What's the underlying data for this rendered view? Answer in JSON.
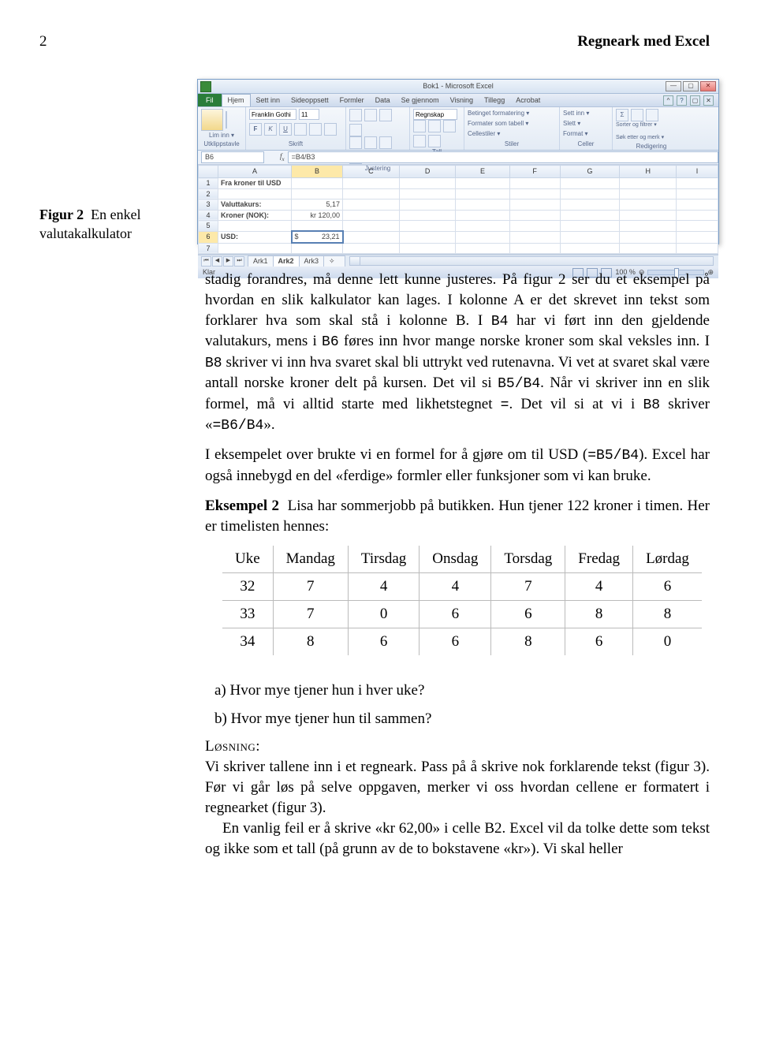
{
  "page": {
    "num": "2",
    "title": "Regneark med Excel"
  },
  "figcap": {
    "label": "Figur 2",
    "text": "En enkel valutakalkulator"
  },
  "excel": {
    "title": "Bok1 - Microsoft Excel",
    "tabs": {
      "file": "Fil",
      "items": [
        "Hjem",
        "Sett inn",
        "Sideoppsett",
        "Formler",
        "Data",
        "Se gjennom",
        "Visning",
        "Tillegg",
        "Acrobat"
      ]
    },
    "ribbon": {
      "clipboard": "Utklippstavle",
      "clipboard_btn": "Lim inn ▾",
      "font": "Skrift",
      "font_name": "Franklin Gothi",
      "font_size": "11",
      "align": "Justering",
      "number": "Tall",
      "number_fmt": "Regnskap",
      "styles": "Stiler",
      "styles_items": [
        "Betinget formatering ▾",
        "Formater som tabell ▾",
        "Cellestiler ▾"
      ],
      "cells": "Celler",
      "cells_items": [
        "Sett inn ▾",
        "Slett ▾",
        "Format ▾"
      ],
      "editing": "Redigering",
      "editing_items": [
        "Sorter og filtrer ▾",
        "Søk etter og merk ▾"
      ]
    },
    "namebox": "B6",
    "formula": "=B4/B3",
    "cols": [
      "",
      "A",
      "B",
      "C",
      "D",
      "E",
      "F",
      "G",
      "H",
      "I"
    ],
    "rows": [
      {
        "r": "1",
        "a": "Fra kroner til USD",
        "b": ""
      },
      {
        "r": "2",
        "a": "",
        "b": ""
      },
      {
        "r": "3",
        "a": "Valuttakurs:",
        "b": "5,17"
      },
      {
        "r": "4",
        "a": "Kroner (NOK):",
        "b": "kr 120,00"
      },
      {
        "r": "5",
        "a": "",
        "b": ""
      },
      {
        "r": "6",
        "a": "USD:",
        "b": "23,21",
        "sel": true,
        "dollar": "$"
      },
      {
        "r": "7",
        "a": "",
        "b": ""
      }
    ],
    "sheets": [
      "Ark1",
      "Ark2",
      "Ark3"
    ],
    "status": "Klar",
    "zoom": "100 %"
  },
  "paras": {
    "p1a": "stadig forandres, må denne lett kunne justeres. På figur 2 ser du et eksempel på hvordan en slik kalkulator kan lages. I kolonne A er det skrevet inn tekst som forklarer hva som skal stå i kolonne B. I ",
    "p1b": " har vi ført inn den gjeldende valutakurs, mens i ",
    "p1c": " føres inn hvor mange norske kroner som skal veksles inn. I ",
    "p1d": " skriver vi inn hva svaret skal bli uttrykt ved rutenavna. Vi vet at svaret skal være antall norske kroner delt på kursen. Det vil si ",
    "p1e": ". Når vi skriver inn en slik formel, må vi alltid starte med likhetstegnet ",
    "p1f": ". Det vil si at vi i ",
    "p1g": " skriver «",
    "p1h": "».",
    "p2a": "I eksempelet over brukte vi en formel for å gjøre om til USD (",
    "p2b": "). Excel har også innebygd en del «ferdige» formler eller funksjoner som vi kan bruke.",
    "eks_label": "Eksempel 2",
    "eks_text": "Lisa har sommerjobb på butikken. Hun tjener 122 kroner i timen. Her er timelisten hennes:",
    "q_a": "a)  Hvor mye tjener hun i hver uke?",
    "q_b": "b)  Hvor mye tjener hun til sammen?",
    "losning_hd": "Løsning:",
    "losning_p1": "Vi skriver tallene inn i et regneark. Pass på å skrive nok forklarende tekst (figur 3). Før vi går løs på selve oppgaven, merker vi oss hvordan cellene er formatert i regnearket (figur 3).",
    "losning_p2": "En vanlig feil er å skrive «kr 62,00» i celle B2. Excel vil da tolke dette som tekst og ikke som et tall (på grunn av de to bokstavene «kr»). Vi skal heller"
  },
  "mono": {
    "b4": "B4",
    "b6": "B6",
    "b8": "B8",
    "b5b4": "B5/B4",
    "eq": "=",
    "eqb6b4": "=B6/B4",
    "eqb5b4": "=B5/B4"
  },
  "chart_data": {
    "type": "table",
    "headers": [
      "Uke",
      "Mandag",
      "Tirsdag",
      "Onsdag",
      "Torsdag",
      "Fredag",
      "Lørdag"
    ],
    "rows": [
      [
        "32",
        "7",
        "4",
        "4",
        "7",
        "4",
        "6"
      ],
      [
        "33",
        "7",
        "0",
        "6",
        "6",
        "8",
        "8"
      ],
      [
        "34",
        "8",
        "6",
        "6",
        "8",
        "6",
        "0"
      ]
    ]
  }
}
